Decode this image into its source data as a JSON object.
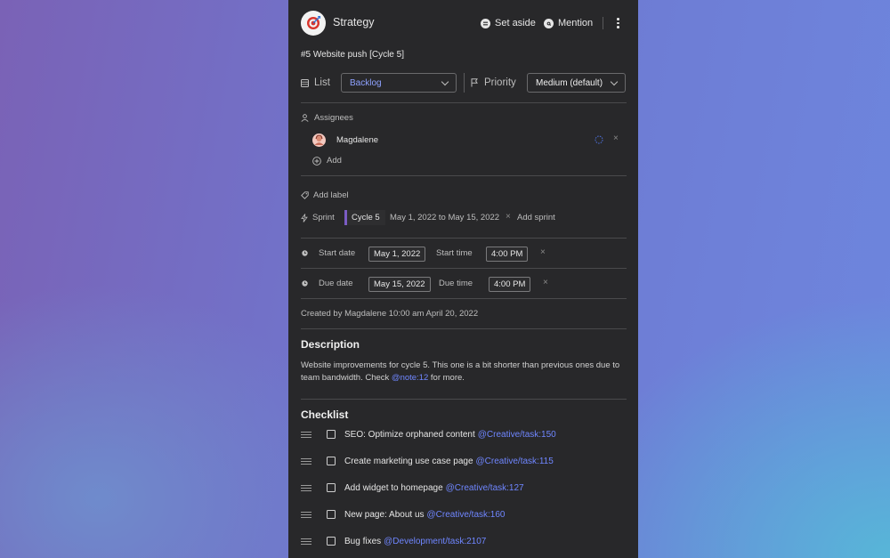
{
  "header": {
    "project_name": "Strategy",
    "set_aside_label": "Set aside",
    "mention_label": "Mention",
    "logo_icon": "target-icon",
    "more_icon": "kebab-icon"
  },
  "task": {
    "title": "#5 Website push [Cycle 5]",
    "list_label": "List",
    "list_value": "Backlog",
    "priority_label": "Priority",
    "priority_value": "Medium (default)"
  },
  "assignees": {
    "label": "Assignees",
    "people": [
      {
        "name": "Magdalene"
      }
    ],
    "add_label": "Add"
  },
  "labels": {
    "add_label": "Add label"
  },
  "sprint": {
    "label": "Sprint",
    "name": "Cycle 5",
    "range": "May 1, 2022 to May 15, 2022",
    "add_label": "Add sprint"
  },
  "dates": {
    "start_label": "Start date",
    "start_date": "May 1, 2022",
    "start_time_label": "Start time",
    "start_time": "4:00 PM",
    "due_label": "Due date",
    "due_date": "May 15, 2022",
    "due_time_label": "Due time",
    "due_time": "4:00 PM"
  },
  "created": "Created by Magdalene 10:00 am April 20, 2022",
  "description": {
    "heading": "Description",
    "text_before": "Website improvements for cycle 5. This one is a bit shorter than previous ones due to team bandwidth. Check ",
    "link": "@note:12",
    "text_after": " for more."
  },
  "checklist": {
    "heading": "Checklist",
    "items": [
      {
        "text": "SEO: Optimize orphaned content",
        "ref": "@Creative/task:150"
      },
      {
        "text": "Create marketing use case page",
        "ref": "@Creative/task:115"
      },
      {
        "text": "Add widget to homepage",
        "ref": "@Creative/task:127"
      },
      {
        "text": "New page: About us",
        "ref": "@Creative/task:160"
      },
      {
        "text": "Bug fixes",
        "ref": "@Development/task:2107"
      }
    ]
  },
  "colors": {
    "panel": "#28282a",
    "link": "#6f86ff",
    "sprint_accent": "#7b5cc4"
  }
}
